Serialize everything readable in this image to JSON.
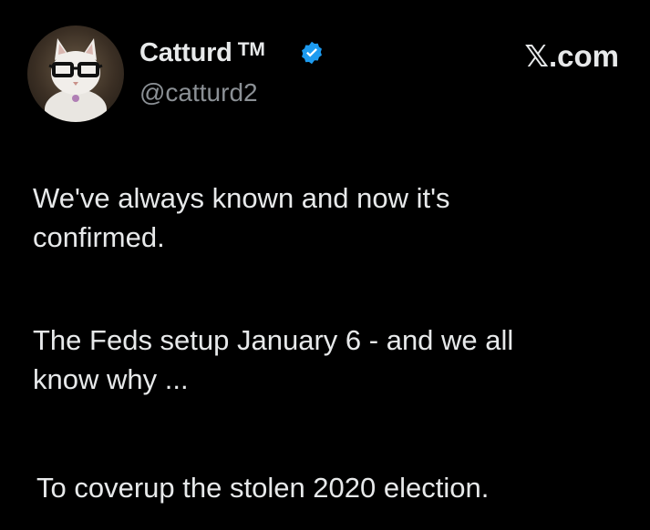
{
  "author": {
    "display_name": "Catturd",
    "trademark": "TM",
    "handle": "@catturd2",
    "verified": true,
    "verified_icon": "verified-badge-icon",
    "avatar_icon": "cat-with-glasses-avatar"
  },
  "site_label": "𝕏.com",
  "paragraphs": [
    "We've always known and now it's\nconfirmed.",
    "The Feds setup January 6 - and we all\nknow why ...",
    "To coverup the stolen 2020 election."
  ],
  "colors": {
    "background": "#000000",
    "text": "#e7e9ea",
    "handle": "#8b9095",
    "verified_blue": "#1d9bf0"
  }
}
